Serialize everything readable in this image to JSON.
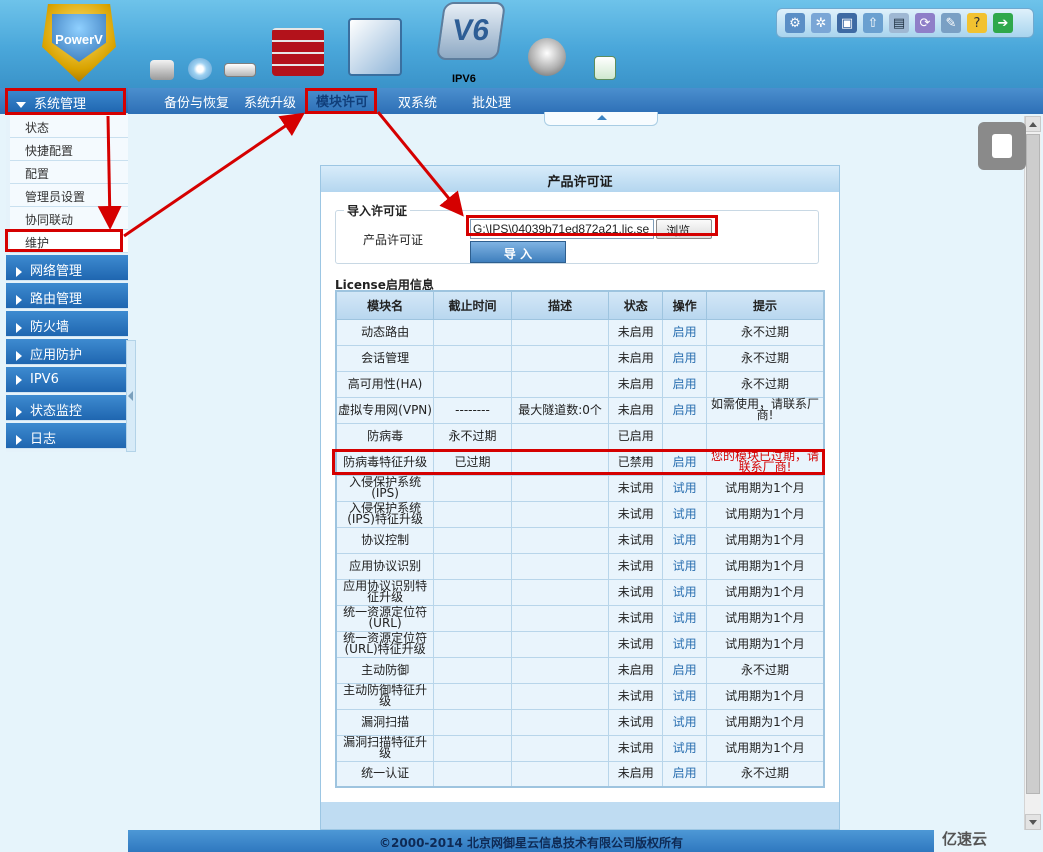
{
  "header": {
    "logo_text": "PowerV",
    "ipv6_label": "IPV6",
    "v6_badge": "V6",
    "toolbar_icons": [
      "network-icon",
      "settings-icon",
      "save-icon",
      "upload-icon",
      "report-icon",
      "refresh-icon",
      "config-icon",
      "help-icon",
      "logout-icon"
    ]
  },
  "nav": {
    "tabs": [
      {
        "label": "备份与恢复"
      },
      {
        "label": "系统升级"
      },
      {
        "label": "模块许可",
        "active": true
      },
      {
        "label": "双系统"
      },
      {
        "label": "批处理"
      }
    ]
  },
  "sidebar": {
    "expanded": {
      "label": "系统管理"
    },
    "sub_items": [
      {
        "label": "状态"
      },
      {
        "label": "快捷配置"
      },
      {
        "label": "配置"
      },
      {
        "label": "管理员设置"
      },
      {
        "label": "协同联动"
      },
      {
        "label": "维护"
      }
    ],
    "sections": [
      {
        "label": "网络管理"
      },
      {
        "label": "路由管理"
      },
      {
        "label": "防火墙"
      },
      {
        "label": "应用防护"
      },
      {
        "label": "IPV6"
      },
      {
        "label": "状态监控"
      },
      {
        "label": "日志"
      }
    ]
  },
  "panel": {
    "title": "产品许可证",
    "import": {
      "legend": "导入许可证",
      "label": "产品许可证",
      "file_value": "G:\\IPS\\04039b71ed872a21.lic.se",
      "browse_label": "浏览...",
      "import_label": "导 入"
    },
    "license_title": "License启用信息",
    "columns": [
      "模块名",
      "截止时间",
      "描述",
      "状态",
      "操作",
      "提示"
    ],
    "rows": [
      {
        "name": "动态路由",
        "deadline": "",
        "desc": "",
        "status": "未启用",
        "op": "启用",
        "tip": "永不过期"
      },
      {
        "name": "会话管理",
        "deadline": "",
        "desc": "",
        "status": "未启用",
        "op": "启用",
        "tip": "永不过期"
      },
      {
        "name": "高可用性(HA)",
        "deadline": "",
        "desc": "",
        "status": "未启用",
        "op": "启用",
        "tip": "永不过期"
      },
      {
        "name": "虚拟专用网(VPN)",
        "deadline": "--------",
        "desc": "最大隧道数:0个",
        "status": "未启用",
        "op": "启用",
        "tip": "如需使用，请联系厂商!"
      },
      {
        "name": "防病毒",
        "deadline": "永不过期",
        "desc": "",
        "status": "已启用",
        "op": "",
        "tip": ""
      },
      {
        "name": "防病毒特征升级",
        "deadline": "已过期",
        "desc": "",
        "status": "已禁用",
        "op": "启用",
        "tip": "您的模块已过期，请联系厂商!",
        "warn": true
      },
      {
        "name": "入侵保护系统(IPS)",
        "deadline": "",
        "desc": "",
        "status": "未试用",
        "op": "试用",
        "tip": "试用期为1个月"
      },
      {
        "name": "入侵保护系统(IPS)特征升级",
        "deadline": "",
        "desc": "",
        "status": "未试用",
        "op": "试用",
        "tip": "试用期为1个月"
      },
      {
        "name": "协议控制",
        "deadline": "",
        "desc": "",
        "status": "未试用",
        "op": "试用",
        "tip": "试用期为1个月"
      },
      {
        "name": "应用协议识别",
        "deadline": "",
        "desc": "",
        "status": "未试用",
        "op": "试用",
        "tip": "试用期为1个月"
      },
      {
        "name": "应用协议识别特征升级",
        "deadline": "",
        "desc": "",
        "status": "未试用",
        "op": "试用",
        "tip": "试用期为1个月"
      },
      {
        "name": "统一资源定位符(URL)",
        "deadline": "",
        "desc": "",
        "status": "未试用",
        "op": "试用",
        "tip": "试用期为1个月"
      },
      {
        "name": "统一资源定位符(URL)特征升级",
        "deadline": "",
        "desc": "",
        "status": "未试用",
        "op": "试用",
        "tip": "试用期为1个月"
      },
      {
        "name": "主动防御",
        "deadline": "",
        "desc": "",
        "status": "未启用",
        "op": "启用",
        "tip": "永不过期"
      },
      {
        "name": "主动防御特征升级",
        "deadline": "",
        "desc": "",
        "status": "未试用",
        "op": "试用",
        "tip": "试用期为1个月"
      },
      {
        "name": "漏洞扫描",
        "deadline": "",
        "desc": "",
        "status": "未试用",
        "op": "试用",
        "tip": "试用期为1个月"
      },
      {
        "name": "漏洞扫描特征升级",
        "deadline": "",
        "desc": "",
        "status": "未试用",
        "op": "试用",
        "tip": "试用期为1个月"
      },
      {
        "name": "统一认证",
        "deadline": "",
        "desc": "",
        "status": "未启用",
        "op": "启用",
        "tip": "永不过期"
      }
    ]
  },
  "footer": {
    "copyright": "©2000-2014 北京网御星云信息技术有限公司版权所有"
  },
  "watermark": "亿速云",
  "colors": {
    "annotation": "#d50000",
    "header": "#4aa7da",
    "nav": "#2d6fb6",
    "warn_text": "#d40000"
  }
}
